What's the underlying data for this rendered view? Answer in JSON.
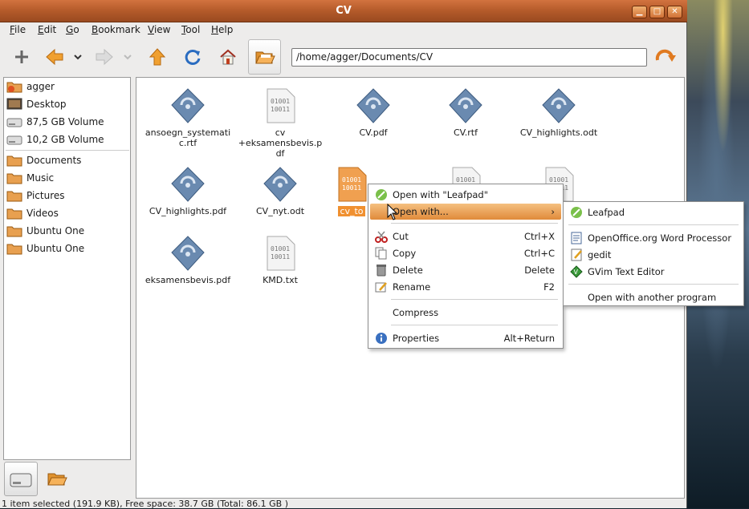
{
  "window": {
    "title": "CV"
  },
  "menubar": [
    {
      "label": "File",
      "u": "F",
      "rest": "ile"
    },
    {
      "label": "Edit",
      "u": "E",
      "rest": "dit"
    },
    {
      "label": "Go",
      "u": "G",
      "rest": "o"
    },
    {
      "label": "Bookmark",
      "u": "B",
      "rest": "ookmark"
    },
    {
      "label": "View",
      "u": "V",
      "rest": "iew"
    },
    {
      "label": "Tool",
      "u": "T",
      "rest": "ool"
    },
    {
      "label": "Help",
      "u": "H",
      "rest": "elp"
    }
  ],
  "location": {
    "path": "/home/agger/Documents/CV"
  },
  "places": {
    "devices": [
      "agger",
      "Desktop",
      "87,5 GB Volume",
      "10,2 GB Volume"
    ],
    "bookmarks": [
      "Documents",
      "Music",
      "Pictures",
      "Videos",
      "Ubuntu One",
      "Ubuntu One"
    ]
  },
  "files": [
    {
      "name": "ansoegn_systemati c.rtf",
      "l1": "ansoegn_systemati",
      "l2": "c.rtf",
      "l3": "",
      "type": "doc"
    },
    {
      "name": "cv +eksamensbevis.pdf",
      "l1": "cv",
      "l2": "+eksamensbevis.p",
      "l3": "df",
      "type": "bin"
    },
    {
      "name": "CV.pdf",
      "l1": "CV.pdf",
      "l2": "",
      "l3": "",
      "type": "doc"
    },
    {
      "name": "CV.rtf",
      "l1": "CV.rtf",
      "l2": "",
      "l3": "",
      "type": "doc"
    },
    {
      "name": "CV_highlights.odt",
      "l1": "CV_highlights.odt",
      "l2": "",
      "l3": "",
      "type": "doc"
    },
    {
      "name": "CV_highlights.pdf",
      "l1": "CV_highlights.pdf",
      "l2": "",
      "l3": "",
      "type": "doc"
    },
    {
      "name": "CV_nyt.odt",
      "l1": "CV_nyt.odt",
      "l2": "",
      "l3": "",
      "type": "doc"
    },
    {
      "name": "cv_to",
      "l1": "cv_to",
      "l2": "",
      "l3": "",
      "type": "bin-sel"
    },
    {
      "name": "",
      "l1": "",
      "l2": "",
      "l3": "",
      "type": "bin"
    },
    {
      "name": "",
      "l1": "",
      "l2": "",
      "l3": "",
      "type": "bin"
    },
    {
      "name": "eksamensbevis.pdf",
      "l1": "eksamensbevis.pdf",
      "l2": "",
      "l3": "",
      "type": "doc"
    },
    {
      "name": "KMD.txt",
      "l1": "KMD.txt",
      "l2": "",
      "l3": "",
      "type": "bin"
    }
  ],
  "context_menu": {
    "open_with_leafpad": "Open with \"Leafpad\"",
    "open_with": "Open with...",
    "cut": "Cut",
    "cut_acc": "Ctrl+X",
    "copy": "Copy",
    "copy_acc": "Ctrl+C",
    "delete": "Delete",
    "delete_acc": "Delete",
    "rename": "Rename",
    "rename_acc": "F2",
    "compress": "Compress",
    "properties": "Properties",
    "properties_acc": "Alt+Return"
  },
  "submenu": {
    "leafpad": "Leafpad",
    "openoffice": "OpenOffice.org Word Processor",
    "gedit": "gedit",
    "gvim": "GVim Text Editor",
    "other": "Open with another program"
  },
  "status": "1 item selected (191.9 KB), Free space: 38.7 GB (Total: 86.1 GB )"
}
